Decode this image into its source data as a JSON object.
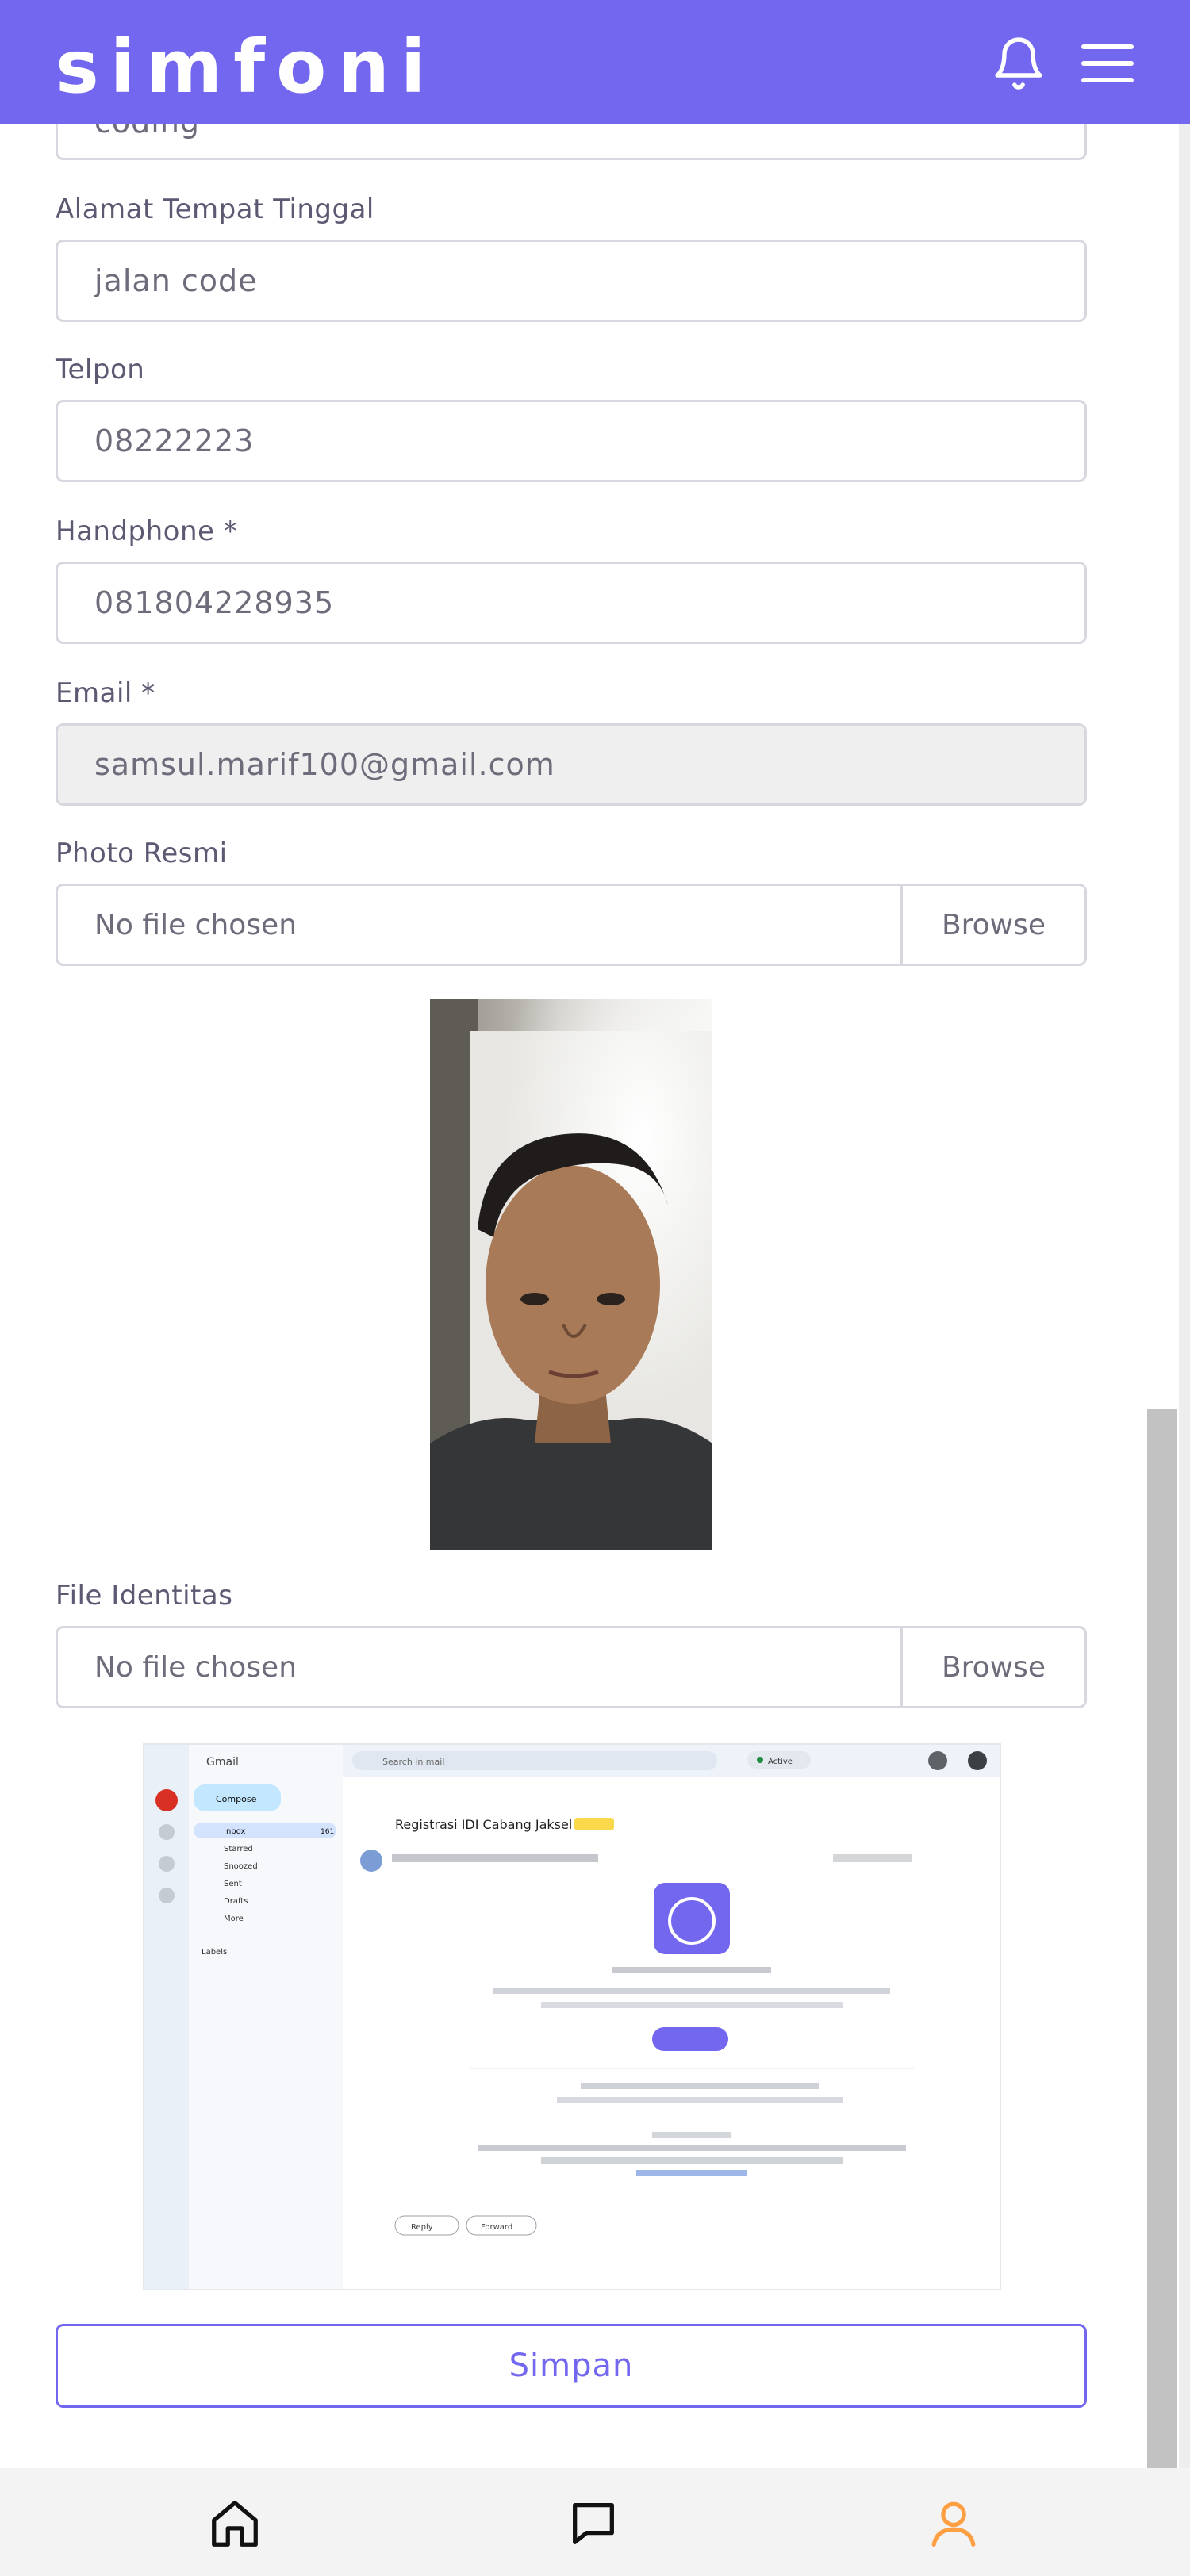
{
  "header": {
    "brand": "simfoni",
    "brand_color": "#7367f0"
  },
  "form": {
    "previous_field_value": "coding",
    "address": {
      "label": "Alamat Tempat Tinggal",
      "value": "jalan code"
    },
    "phone": {
      "label": "Telpon",
      "value": "08222223"
    },
    "handphone": {
      "label": "Handphone *",
      "value": "081804228935"
    },
    "email": {
      "label": "Email *",
      "value": "samsul.marif100@gmail.com"
    },
    "photo": {
      "label": "Photo Resmi",
      "file_text": "No file chosen",
      "browse_label": "Browse"
    },
    "identity": {
      "label": "File Identitas",
      "file_text": "No file chosen",
      "browse_label": "Browse"
    },
    "submit_label": "Simpan"
  },
  "id_preview": {
    "app": "Gmail",
    "search_placeholder": "Search in mail",
    "status": "Active",
    "compose": "Compose",
    "folders": [
      "Inbox",
      "Starred",
      "Snoozed",
      "Sent",
      "Drafts",
      "More"
    ],
    "inbox_count": "161",
    "labels_heading": "Labels",
    "subject": "Registrasi IDI Cabang Jaksel",
    "reply": "Reply",
    "forward": "Forward"
  },
  "bottom_nav": {
    "items": [
      {
        "icon": "home-icon"
      },
      {
        "icon": "chat-icon"
      },
      {
        "icon": "user-icon",
        "active": true
      }
    ],
    "active_color": "#ff9f43"
  }
}
